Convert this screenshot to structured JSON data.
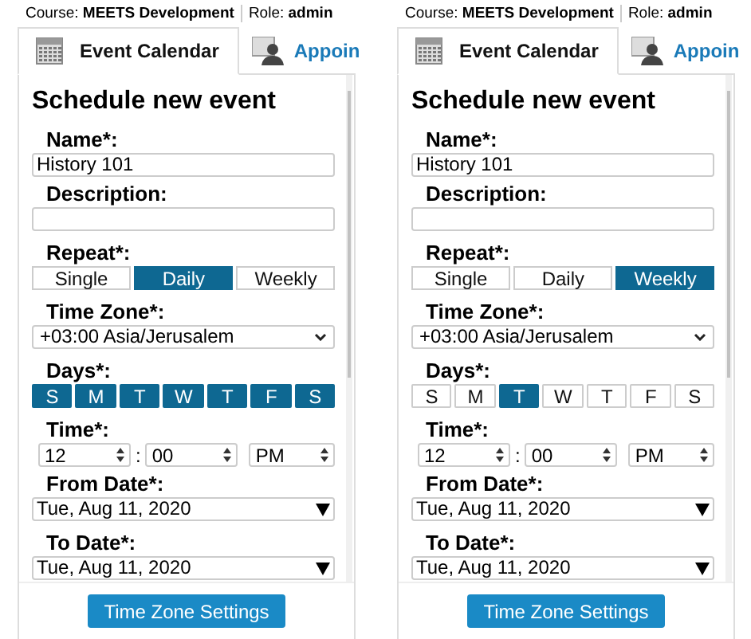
{
  "panels": [
    {
      "header": {
        "course_label": "Course:",
        "course": "MEETS Development",
        "role_label": "Role:",
        "role": "admin"
      },
      "tabs": [
        {
          "label": "Event Calendar",
          "selected": true,
          "kind": "calendar"
        },
        {
          "label": "Appoin",
          "selected": false,
          "kind": "person"
        }
      ],
      "title": "Schedule new event",
      "name": {
        "label": "Name*:",
        "value": "History 101"
      },
      "description": {
        "label": "Description:"
      },
      "repeat": {
        "label": "Repeat*:",
        "options": [
          {
            "label": "Single",
            "selected": false
          },
          {
            "label": "Daily",
            "selected": true
          },
          {
            "label": "Weekly",
            "selected": false
          }
        ]
      },
      "time_zone": {
        "label": "Time Zone*:",
        "value": "+03:00 Asia/Jerusalem"
      },
      "days": {
        "label": "Days*:",
        "items": [
          {
            "label": "S",
            "selected": true
          },
          {
            "label": "M",
            "selected": true
          },
          {
            "label": "T",
            "selected": true
          },
          {
            "label": "W",
            "selected": true
          },
          {
            "label": "T",
            "selected": true
          },
          {
            "label": "F",
            "selected": true
          },
          {
            "label": "S",
            "selected": true
          }
        ]
      },
      "time": {
        "label": "Time*:",
        "hour": "12",
        "separator": ":",
        "minute": "00",
        "period": "PM"
      },
      "from_date": {
        "label": "From Date*:",
        "value": "Tue, Aug 11, 2020"
      },
      "to_date": {
        "label": "To Date*:",
        "value": "Tue, Aug 11, 2020"
      },
      "button": "Time Zone Settings"
    },
    {
      "header": {
        "course_label": "Course:",
        "course": "MEETS Development",
        "role_label": "Role:",
        "role": "admin"
      },
      "tabs": [
        {
          "label": "Event Calendar",
          "selected": true,
          "kind": "calendar"
        },
        {
          "label": "Appoin",
          "selected": false,
          "kind": "person"
        }
      ],
      "title": "Schedule new event",
      "name": {
        "label": "Name*:",
        "value": "History 101"
      },
      "description": {
        "label": "Description:"
      },
      "repeat": {
        "label": "Repeat*:",
        "options": [
          {
            "label": "Single",
            "selected": false
          },
          {
            "label": "Daily",
            "selected": false
          },
          {
            "label": "Weekly",
            "selected": true
          }
        ]
      },
      "time_zone": {
        "label": "Time Zone*:",
        "value": "+03:00 Asia/Jerusalem"
      },
      "days": {
        "label": "Days*:",
        "items": [
          {
            "label": "S",
            "selected": false
          },
          {
            "label": "M",
            "selected": false
          },
          {
            "label": "T",
            "selected": true
          },
          {
            "label": "W",
            "selected": false
          },
          {
            "label": "T",
            "selected": false
          },
          {
            "label": "F",
            "selected": false
          },
          {
            "label": "S",
            "selected": false
          }
        ]
      },
      "time": {
        "label": "Time*:",
        "hour": "12",
        "separator": ":",
        "minute": "00",
        "period": "PM"
      },
      "from_date": {
        "label": "From Date*:",
        "value": "Tue, Aug 11, 2020"
      },
      "to_date": {
        "label": "To Date*:",
        "value": "Tue, Aug 11, 2020"
      },
      "button": "Time Zone Settings"
    }
  ]
}
